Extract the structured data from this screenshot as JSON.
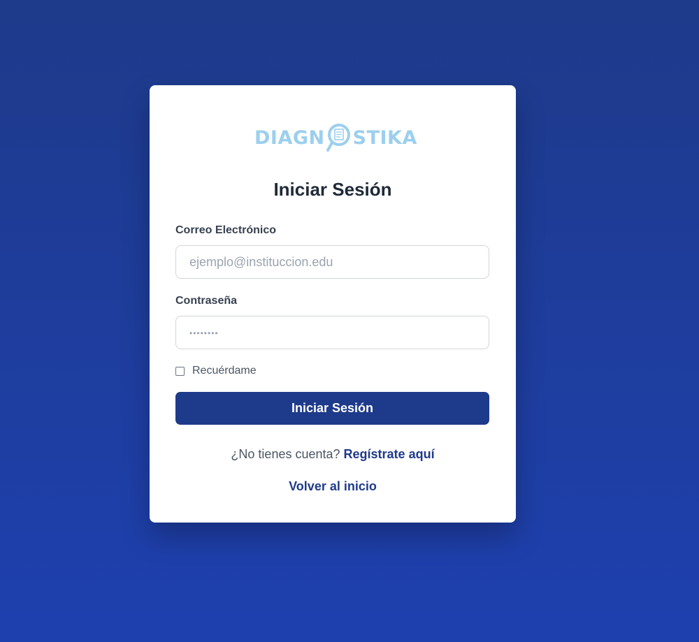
{
  "logo": {
    "text_before": "DIAGN",
    "text_after": "STIKA",
    "icon": "magnifier-document-icon",
    "color": "#9ccfee"
  },
  "login": {
    "title": "Iniciar Sesión",
    "email_label": "Correo Electrónico",
    "email_placeholder": "ejemplo@instituccion.edu",
    "password_label": "Contraseña",
    "password_mask": "••••••••",
    "remember_label": "Recuérdame",
    "remember_checked": false,
    "submit_label": "Iniciar Sesión",
    "register_prompt": "¿No tienes cuenta?",
    "register_link": "Regístrate aquí",
    "back_link": "Volver al inicio"
  },
  "colors": {
    "background": "#1e40af",
    "primary": "#1e3a8a",
    "card": "#ffffff"
  }
}
